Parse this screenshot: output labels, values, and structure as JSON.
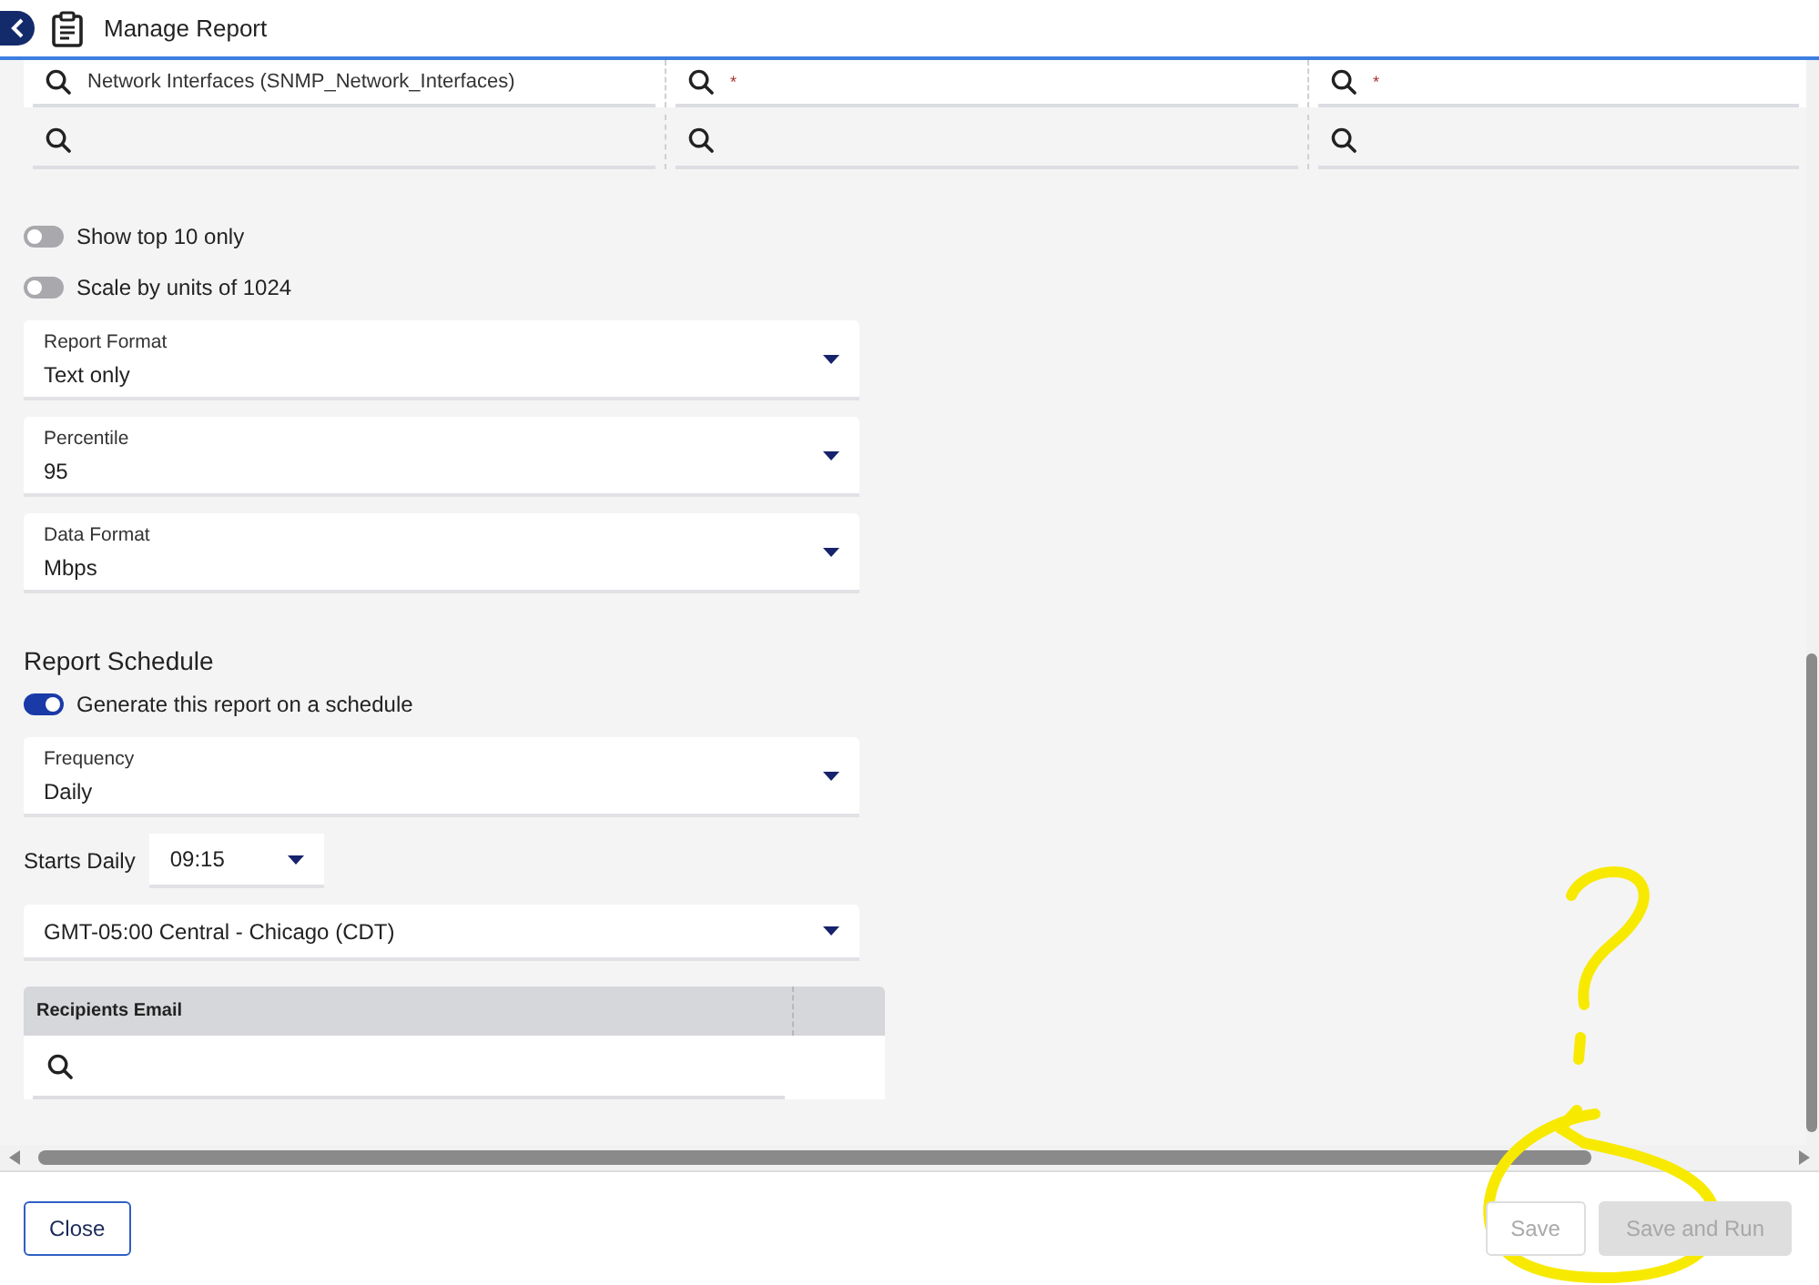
{
  "header": {
    "title": "Manage Report"
  },
  "filter_rows": [
    {
      "kind": "value",
      "fields": [
        {
          "kind": "search",
          "value": "Network Interfaces (SNMP_Network_Interfaces)"
        },
        {
          "kind": "search",
          "value": "*"
        },
        {
          "kind": "search",
          "value": "*"
        }
      ]
    },
    {
      "kind": "search",
      "fields": [
        {
          "kind": "search"
        },
        {
          "kind": "search"
        },
        {
          "kind": "search"
        }
      ]
    }
  ],
  "toggles": [
    {
      "label": "Show top 10 only",
      "on": false
    },
    {
      "label": "Scale by units of 1024",
      "on": false
    }
  ],
  "selects": [
    {
      "label": "Report Format",
      "value": "Text only"
    },
    {
      "label": "Percentile",
      "value": "95"
    },
    {
      "label": "Data Format",
      "value": "Mbps"
    }
  ],
  "schedule": {
    "title": "Report Schedule",
    "toggle": {
      "label": "Generate this report on a schedule",
      "on": true
    },
    "frequency": {
      "label": "Frequency",
      "value": "Daily"
    },
    "start": {
      "label": "Starts Daily",
      "value": "09:15"
    },
    "timezone": {
      "value": "GMT-05:00 Central - Chicago (CDT)"
    },
    "recipients": {
      "column": "Recipients Email"
    }
  },
  "footer": {
    "buttons": [
      {
        "label": "Close",
        "kind": "outline",
        "disabled": false
      },
      {
        "label": "Save",
        "kind": "outline",
        "disabled": true
      },
      {
        "label": "Save and Run",
        "kind": "filled",
        "disabled": true
      }
    ]
  }
}
